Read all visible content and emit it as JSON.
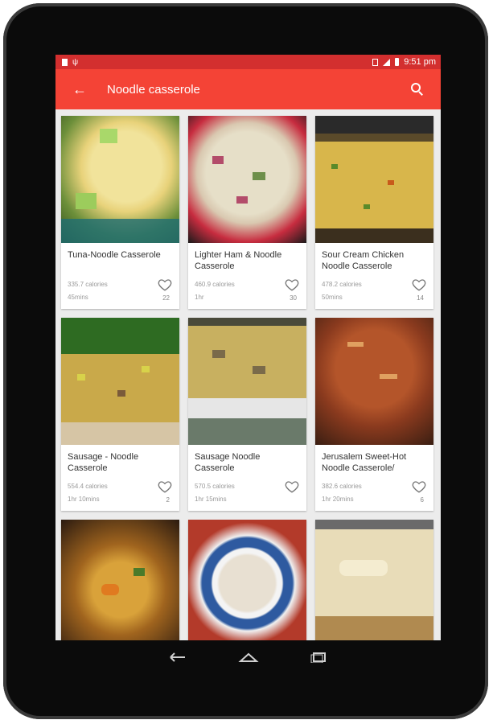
{
  "status_bar": {
    "time": "9:51 pm"
  },
  "app_bar": {
    "title": "Noodle casserole"
  },
  "recipes": [
    {
      "name": "Tuna-Noodle Casserole",
      "calories": "335.7 calories",
      "time": "45mins",
      "likes": "22"
    },
    {
      "name": "Lighter Ham & Noodle Casserole",
      "calories": "460.9 calories",
      "time": "1hr",
      "likes": "30"
    },
    {
      "name": "Sour Cream Chicken Noodle Casserole",
      "calories": "478.2 calories",
      "time": "50mins",
      "likes": "14"
    },
    {
      "name": "Sausage - Noodle Casserole",
      "calories": "554.4 calories",
      "time": "1hr 10mins",
      "likes": "2"
    },
    {
      "name": "Sausage Noodle Casserole",
      "calories": "570.5 calories",
      "time": "1hr 15mins",
      "likes": ""
    },
    {
      "name": "Jerusalem Sweet-Hot Noodle Casserole/",
      "calories": "382.6 calories",
      "time": "1hr 20mins",
      "likes": "6"
    },
    {
      "name": "",
      "calories": "",
      "time": "",
      "likes": ""
    },
    {
      "name": "",
      "calories": "",
      "time": "",
      "likes": ""
    },
    {
      "name": "",
      "calories": "",
      "time": "",
      "likes": ""
    }
  ],
  "colors": {
    "app_bar": "#f44336",
    "status_bar": "#d32f2f",
    "background": "#ececec"
  },
  "icons": {
    "back": "arrow-left",
    "search": "magnifier",
    "favorite": "heart-outline",
    "nav_back": "back-arrow",
    "nav_home": "home",
    "nav_recents": "recents"
  }
}
